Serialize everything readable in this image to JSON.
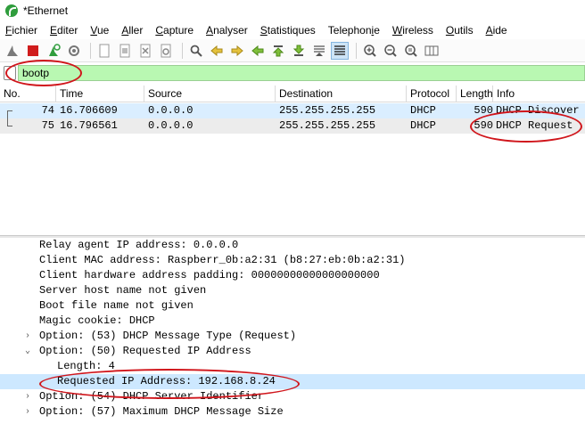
{
  "window": {
    "title": "*Ethernet"
  },
  "menu": [
    {
      "pre": "",
      "u": "F",
      "post": "ichier"
    },
    {
      "pre": "",
      "u": "E",
      "post": "diter"
    },
    {
      "pre": "",
      "u": "V",
      "post": "ue"
    },
    {
      "pre": "",
      "u": "A",
      "post": "ller"
    },
    {
      "pre": "",
      "u": "C",
      "post": "apture"
    },
    {
      "pre": "",
      "u": "A",
      "post": "nalyser"
    },
    {
      "pre": "",
      "u": "S",
      "post": "tatistiques"
    },
    {
      "pre": "Telephon",
      "u": "i",
      "post": "e"
    },
    {
      "pre": "",
      "u": "W",
      "post": "ireless"
    },
    {
      "pre": "",
      "u": "O",
      "post": "utils"
    },
    {
      "pre": "",
      "u": "A",
      "post": "ide"
    }
  ],
  "filter": {
    "value": "bootp"
  },
  "columns": {
    "no": "No.",
    "time": "Time",
    "source": "Source",
    "destination": "Destination",
    "protocol": "Protocol",
    "length": "Length",
    "info": "Info"
  },
  "packets": [
    {
      "no": "74",
      "time": "16.706609",
      "source": "0.0.0.0",
      "destination": "255.255.255.255",
      "protocol": "DHCP",
      "length": "590",
      "info": "DHCP Discover"
    },
    {
      "no": "75",
      "time": "16.796561",
      "source": "0.0.0.0",
      "destination": "255.255.255.255",
      "protocol": "DHCP",
      "length": "590",
      "info": "DHCP Request"
    }
  ],
  "details": [
    {
      "text": "Relay agent IP address: 0.0.0.0",
      "arrow": ""
    },
    {
      "text": "Client MAC address: Raspberr_0b:a2:31 (b8:27:eb:0b:a2:31)",
      "arrow": ""
    },
    {
      "text": "Client hardware address padding: 00000000000000000000",
      "arrow": ""
    },
    {
      "text": "Server host name not given",
      "arrow": ""
    },
    {
      "text": "Boot file name not given",
      "arrow": ""
    },
    {
      "text": "Magic cookie: DHCP",
      "arrow": ""
    },
    {
      "text": "Option: (53) DHCP Message Type (Request)",
      "arrow": "›"
    },
    {
      "text": "Option: (50) Requested IP Address",
      "arrow": "⌄"
    },
    {
      "text": "Length: 4",
      "arrow": ""
    },
    {
      "text": "Requested IP Address: 192.168.8.24",
      "arrow": ""
    },
    {
      "text": "Option: (54) DHCP Server Identifier",
      "arrow": "›"
    },
    {
      "text": "Option: (57) Maximum DHCP Message Size",
      "arrow": "›"
    }
  ],
  "colors": {
    "filter_bg": "#b9f8b2",
    "selected_row": "#daeeff",
    "annotation": "#d0151b"
  }
}
